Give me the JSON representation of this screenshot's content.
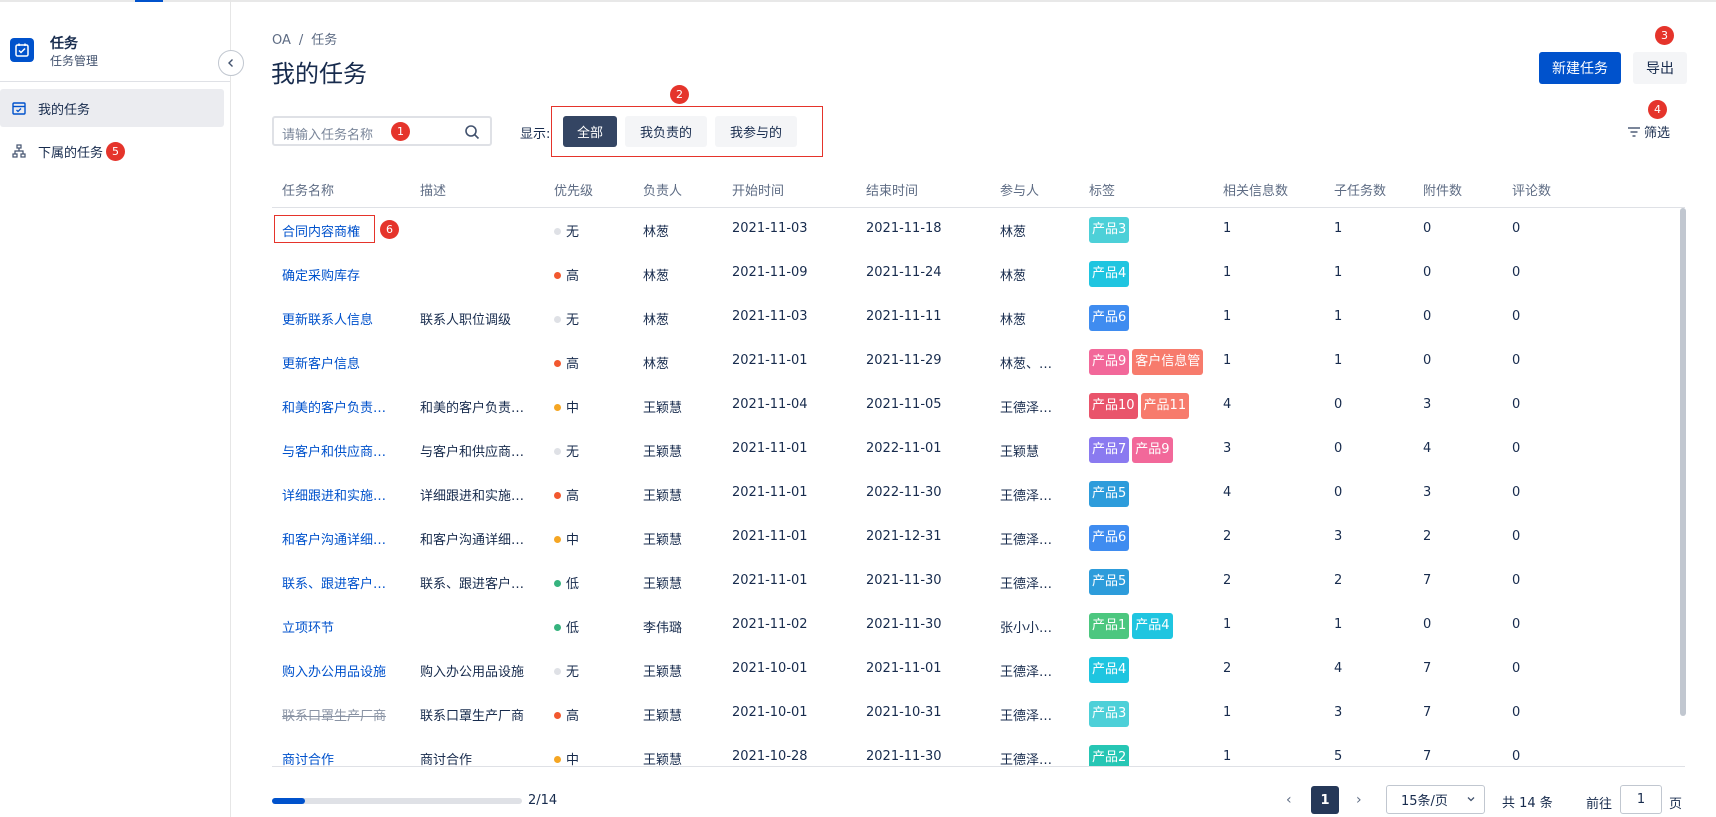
{
  "app": {
    "title": "任务",
    "subtitle": "任务管理"
  },
  "sidebar": {
    "items": [
      {
        "label": "我的任务",
        "active": true
      },
      {
        "label": "下属的任务",
        "badge": "5"
      }
    ]
  },
  "breadcrumb": {
    "root": "OA",
    "sep": "/",
    "current": "任务"
  },
  "page": {
    "title": "我的任务"
  },
  "toolbar": {
    "new_task": "新建任务",
    "export": "导出",
    "export_badge": "3",
    "filter": "筛选",
    "filter_badge": "4"
  },
  "search": {
    "placeholder": "请输入任务名称",
    "badge": "1"
  },
  "display": {
    "label": "显示:",
    "badge": "2",
    "options": [
      "全部",
      "我负责的",
      "我参与的"
    ],
    "selected": "全部"
  },
  "table": {
    "columns": [
      "任务名称",
      "描述",
      "优先级",
      "负责人",
      "开始时间",
      "结束时间",
      "参与人",
      "标签",
      "相关信息数",
      "子任务数",
      "附件数",
      "评论数"
    ],
    "first_row_badge": "6",
    "rows": [
      {
        "name": "合同内容商榷",
        "desc": "",
        "priority": "无",
        "owner": "林葱",
        "start": "2021-11-03",
        "end": "2021-11-18",
        "participants": "林葱",
        "tags": [
          {
            "t": "产品3",
            "c": "#4dd0d8"
          }
        ],
        "info": "1",
        "subtasks": "1",
        "attachments": "0",
        "comments": "0"
      },
      {
        "name": "确定采购库存",
        "desc": "",
        "priority": "高",
        "owner": "林葱",
        "start": "2021-11-09",
        "end": "2021-11-24",
        "participants": "林葱",
        "tags": [
          {
            "t": "产品4",
            "c": "#1fc5e0"
          }
        ],
        "info": "1",
        "subtasks": "1",
        "attachments": "0",
        "comments": "0"
      },
      {
        "name": "更新联系人信息",
        "desc": "联系人职位调级",
        "priority": "无",
        "owner": "林葱",
        "start": "2021-11-03",
        "end": "2021-11-11",
        "participants": "林葱",
        "tags": [
          {
            "t": "产品6",
            "c": "#3f8cf0"
          }
        ],
        "info": "1",
        "subtasks": "1",
        "attachments": "0",
        "comments": "0"
      },
      {
        "name": "更新客户信息",
        "desc": "",
        "priority": "高",
        "owner": "林葱",
        "start": "2021-11-01",
        "end": "2021-11-29",
        "participants": "林葱、…",
        "tags": [
          {
            "t": "产品9",
            "c": "#f2689a"
          },
          {
            "t": "客户信息管",
            "c": "#f77b6c"
          }
        ],
        "info": "1",
        "subtasks": "1",
        "attachments": "0",
        "comments": "0"
      },
      {
        "name": "和美的客户负责…",
        "desc": "和美的客户负责…",
        "priority": "中",
        "owner": "王颖慧",
        "start": "2021-11-04",
        "end": "2021-11-05",
        "participants": "王德泽…",
        "tags": [
          {
            "t": "产品10",
            "c": "#e9546b"
          },
          {
            "t": "产品11",
            "c": "#f77b6c"
          }
        ],
        "info": "4",
        "subtasks": "0",
        "attachments": "3",
        "comments": "0"
      },
      {
        "name": "与客户和供应商…",
        "desc": "与客户和供应商…",
        "priority": "无",
        "owner": "王颖慧",
        "start": "2021-11-01",
        "end": "2022-11-01",
        "participants": "王颖慧",
        "tags": [
          {
            "t": "产品7",
            "c": "#8a7af0"
          },
          {
            "t": "产品9",
            "c": "#f2689a"
          }
        ],
        "info": "3",
        "subtasks": "0",
        "attachments": "4",
        "comments": "0"
      },
      {
        "name": "详细跟进和实施…",
        "desc": "详细跟进和实施…",
        "priority": "高",
        "owner": "王颖慧",
        "start": "2021-11-01",
        "end": "2022-11-30",
        "participants": "王德泽…",
        "tags": [
          {
            "t": "产品5",
            "c": "#2d9cdb"
          }
        ],
        "info": "4",
        "subtasks": "0",
        "attachments": "3",
        "comments": "0"
      },
      {
        "name": "和客户沟通详细…",
        "desc": "和客户沟通详细…",
        "priority": "中",
        "owner": "王颖慧",
        "start": "2021-11-01",
        "end": "2021-12-31",
        "participants": "王德泽…",
        "tags": [
          {
            "t": "产品6",
            "c": "#3f8cf0"
          }
        ],
        "info": "2",
        "subtasks": "3",
        "attachments": "2",
        "comments": "0"
      },
      {
        "name": "联系、跟进客户…",
        "desc": "联系、跟进客户…",
        "priority": "低",
        "owner": "王颖慧",
        "start": "2021-11-01",
        "end": "2021-11-30",
        "participants": "王德泽…",
        "tags": [
          {
            "t": "产品5",
            "c": "#2d9cdb"
          }
        ],
        "info": "2",
        "subtasks": "2",
        "attachments": "7",
        "comments": "0"
      },
      {
        "name": "立项环节",
        "desc": "",
        "priority": "低",
        "owner": "李伟璐",
        "start": "2021-11-02",
        "end": "2021-11-30",
        "participants": "张小小…",
        "tags": [
          {
            "t": "产品1",
            "c": "#4cc77f"
          },
          {
            "t": "产品4",
            "c": "#1fc5e0"
          }
        ],
        "info": "1",
        "subtasks": "1",
        "attachments": "0",
        "comments": "0"
      },
      {
        "name": "购入办公用品设施",
        "desc": "购入办公用品设施",
        "priority": "无",
        "owner": "王颖慧",
        "start": "2021-10-01",
        "end": "2021-11-01",
        "participants": "王德泽…",
        "tags": [
          {
            "t": "产品4",
            "c": "#1fc5e0"
          }
        ],
        "info": "2",
        "subtasks": "4",
        "attachments": "7",
        "comments": "0"
      },
      {
        "name": "联系口罩生产厂商",
        "desc": "联系口罩生产厂商",
        "priority": "高",
        "owner": "王颖慧",
        "start": "2021-10-01",
        "end": "2021-10-31",
        "participants": "王德泽…",
        "tags": [
          {
            "t": "产品3",
            "c": "#4dd0d8"
          }
        ],
        "info": "1",
        "subtasks": "3",
        "attachments": "7",
        "comments": "0",
        "struck": true
      },
      {
        "name": "商讨合作",
        "desc": "商讨合作",
        "priority": "中",
        "owner": "王颖慧",
        "start": "2021-10-28",
        "end": "2021-11-30",
        "participants": "王德泽…",
        "tags": [
          {
            "t": "产品2",
            "c": "#26c6b4"
          }
        ],
        "info": "1",
        "subtasks": "5",
        "attachments": "7",
        "comments": "0"
      }
    ]
  },
  "priority_colors": {
    "无": "#dfe1e6",
    "高": "#f2582f",
    "中": "#f5a623",
    "低": "#36b37e"
  },
  "footer": {
    "progress_text": "2/14",
    "progress_fraction": 0.13,
    "current_page": "1",
    "page_size": "15条/页",
    "total": "共 14 条",
    "goto_label": "前往",
    "goto_value": "1",
    "page_unit": "页"
  }
}
